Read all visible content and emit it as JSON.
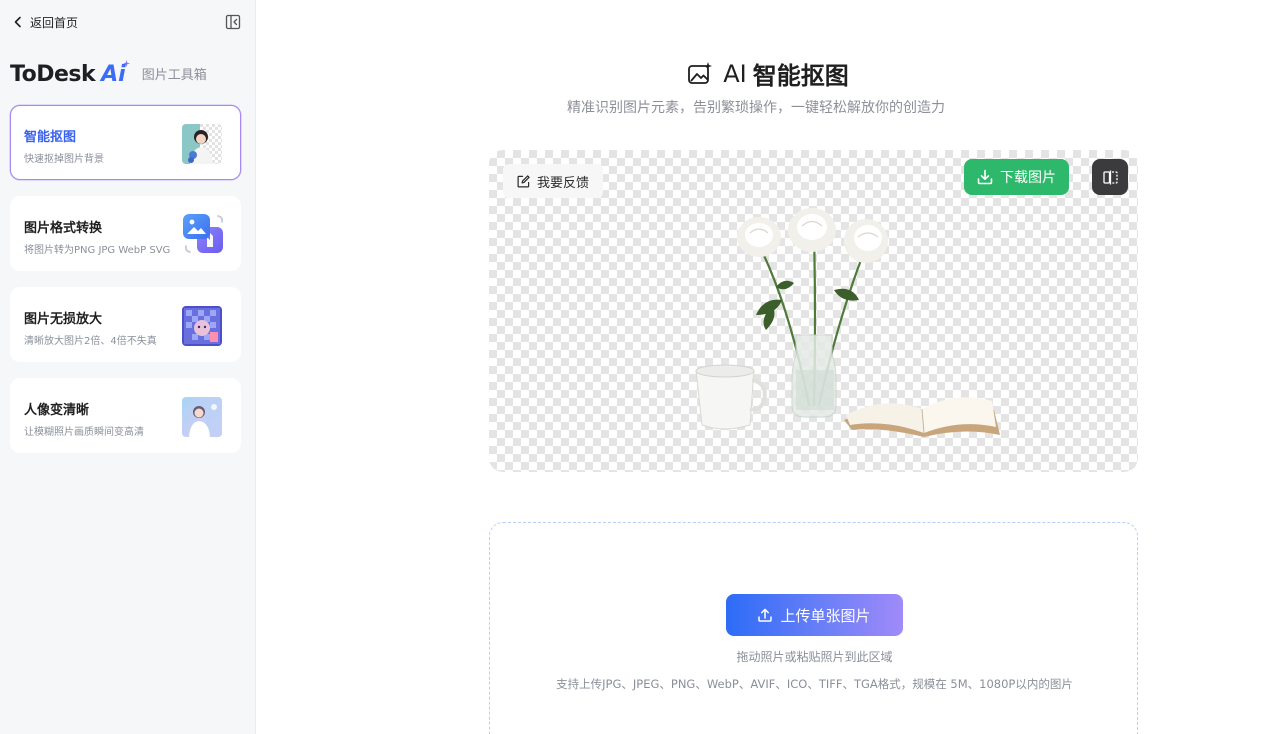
{
  "sidebar": {
    "back_label": "返回首页",
    "brand": {
      "name": "ToDesk",
      "ai": "Ai",
      "subtitle": "图片工具箱"
    },
    "tools": [
      {
        "title": "智能抠图",
        "desc": "快速抠掉图片背景",
        "active": true
      },
      {
        "title": "图片格式转换",
        "desc": "将图片转为PNG JPG WebP SVG",
        "active": false
      },
      {
        "title": "图片无损放大",
        "desc": "清晰放大图片2倍、4倍不失真",
        "active": false
      },
      {
        "title": "人像变清晰",
        "desc": "让模糊照片画质瞬间变高清",
        "active": false
      }
    ]
  },
  "main": {
    "title_ai": "AI",
    "title_cn": "智能抠图",
    "subtitle": "精准识别图片元素，告别繁琐操作，一键轻松解放你的创造力",
    "preview": {
      "feedback_label": "我要反馈",
      "download_label": "下载图片"
    },
    "upload": {
      "button_label": "上传单张图片",
      "hint": "拖动照片或粘贴照片到此区域",
      "formats": "支持上传JPG、JPEG、PNG、WebP、AVIF、ICO、TIFF、TGA格式，规模在 5M、1080P以内的图片"
    }
  },
  "colors": {
    "accent_blue": "#3a62f0",
    "download_green": "#2eb86b",
    "active_border": "#a689f5"
  },
  "icons": {
    "back": "chevron-left-icon",
    "collapse": "sidebar-collapse-icon",
    "title": "image-sparkle-icon",
    "feedback": "edit-icon",
    "download": "download-icon",
    "compare": "compare-icon",
    "upload": "upload-icon"
  }
}
